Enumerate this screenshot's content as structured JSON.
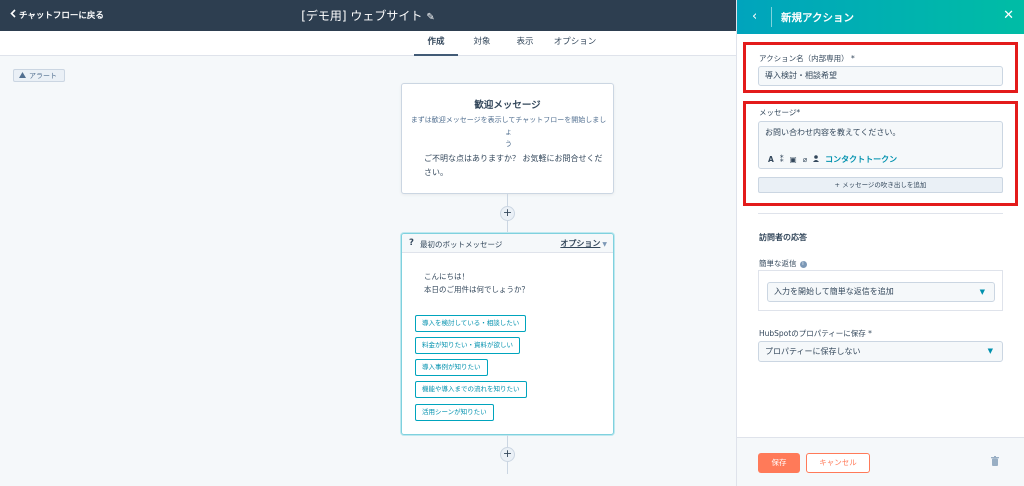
{
  "header": {
    "back_label": "チャットフローに戻る",
    "title": "[デモ用] ウェブサイト"
  },
  "tabs": [
    {
      "label": "作成",
      "active": true
    },
    {
      "label": "対象",
      "active": false
    },
    {
      "label": "表示",
      "active": false
    },
    {
      "label": "オプション",
      "active": false
    }
  ],
  "alert": {
    "label": "アラート"
  },
  "welcome": {
    "title": "歓迎メッセージ",
    "subtitle_line1": "まずは歓迎メッセージを表示してチャットフローを開始しましょ",
    "subtitle_line2": "う",
    "body": "ご不明な点はありますか？ お気軽にお問合せください。"
  },
  "bot": {
    "number": "?",
    "title": "最初のボットメッセージ",
    "options_label": "オプション",
    "line1": "こんにちは！",
    "line2": "本日のご用件は何でしょうか？",
    "quick_replies": [
      "導入を検討している・相談したい",
      "料金が知りたい・資料が欲しい",
      "導入事例が知りたい",
      "機能や導入までの流れを知りたい",
      "活用シーンが知りたい"
    ]
  },
  "panel": {
    "title": "新規アクション",
    "action_name_label": "アクション名（内部専用）",
    "required_mark": "*",
    "action_name_value": "導入検討・相談希望",
    "message_label": "メッセージ",
    "message_value": "お問い合わせ内容を教えてください。",
    "contact_token_label": "コンタクトトークン",
    "add_bubble_label": "メッセージの吹き出しを追加",
    "visitor_response_heading": "訪問者の応答",
    "quick_reply_label": "簡単な返信",
    "quick_reply_placeholder": "入力を開始して簡単な返信を追加",
    "save_property_label": "HubSpotのプロパティーに保存",
    "save_property_value": "プロパティーに保存しない",
    "save_label": "保存",
    "cancel_label": "キャンセル"
  },
  "colors": {
    "topbar": "#2d3e50",
    "accent_teal": "#00a4bd",
    "save_orange": "#ff7a59",
    "highlight_red": "#e31b1b"
  }
}
